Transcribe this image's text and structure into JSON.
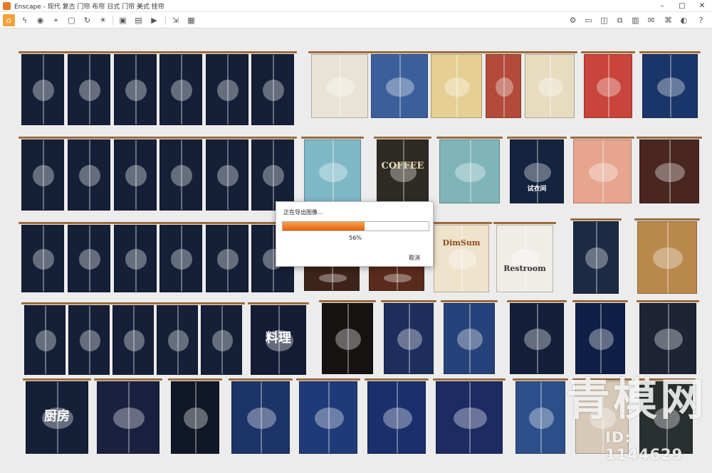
{
  "window": {
    "title": "Enscape - 现代 复古 门帘 布帘 日式 门帘 美式 挂帘",
    "minimize": "–",
    "maximize": "□",
    "close": "✕"
  },
  "toolbar": {
    "help": "?",
    "icons": [
      "home-icon",
      "lightning-icon",
      "camera-icon",
      "pin-icon",
      "box-icon",
      "undo-icon",
      "rotate-icon",
      "light-icon",
      "video-icon",
      "render-icon",
      "asset-icon",
      "panorama-icon",
      "batch-icon",
      "export-icon",
      "settings-icon",
      "view-icon",
      "capture-icon",
      "grid-icon",
      "vr-icon",
      "feedback-icon",
      "help-icon"
    ]
  },
  "dialog": {
    "title": "正在导出图像...",
    "percent_text": "56%",
    "progress": 0.56,
    "cancel": "取消"
  },
  "watermark": {
    "text": "青模网",
    "id": "ID: 1144629"
  },
  "curtain_texts": {
    "dimsum": "DimSum",
    "restroom": "Restroom",
    "coffee": "COFFEE",
    "fitting": "试衣间",
    "ryo": "料理",
    "shashin": "厨房"
  },
  "colors": {
    "navy": "#152038",
    "accent": "#e9600f",
    "rod": "#9c6b3c"
  }
}
